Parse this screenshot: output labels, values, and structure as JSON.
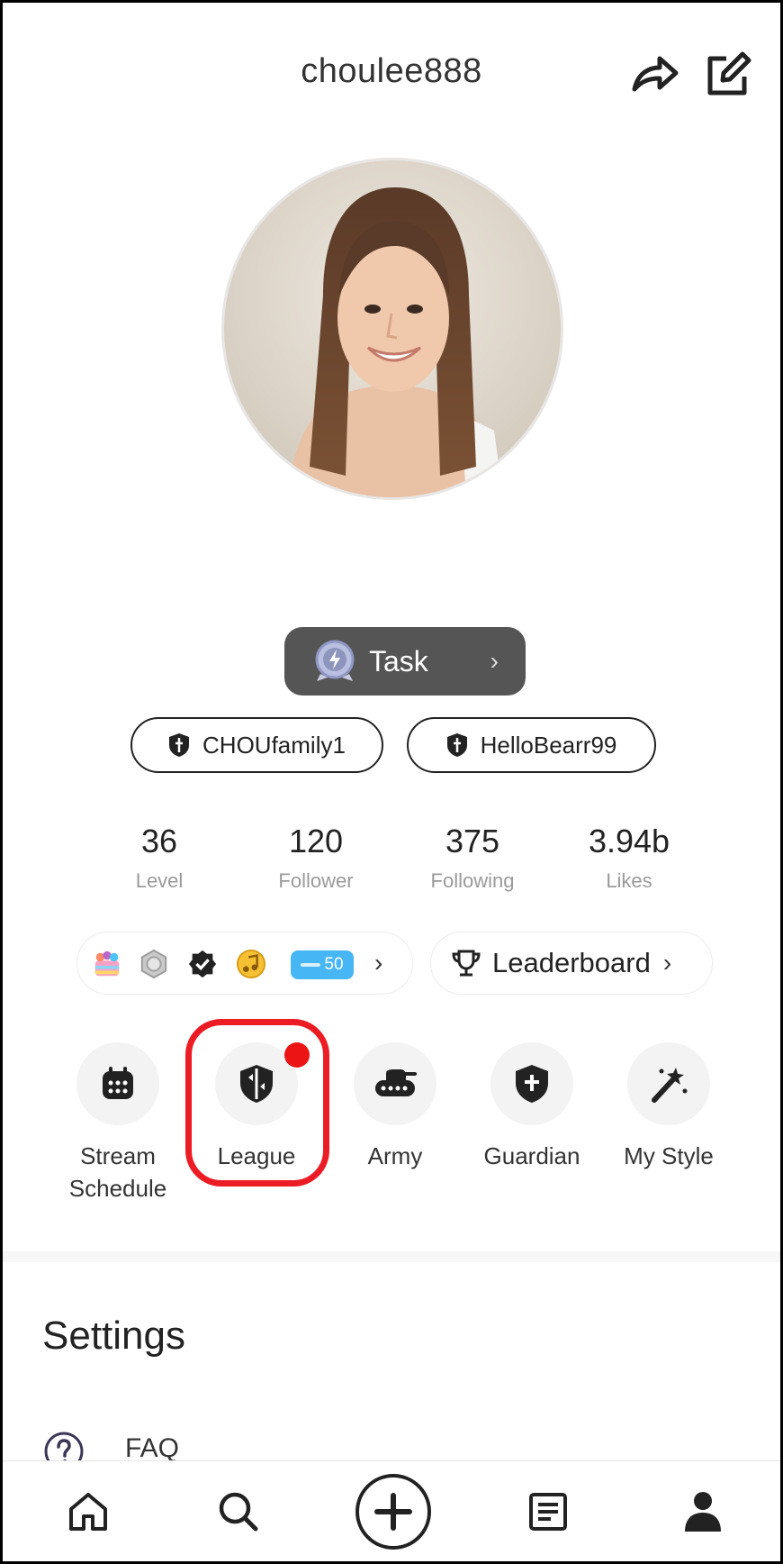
{
  "header": {
    "username": "choulee888",
    "share_icon": "share-icon",
    "edit_icon": "edit-icon"
  },
  "profile": {
    "avatar_alt": "profile photo"
  },
  "task": {
    "label": "Task",
    "icon": "task-medal-icon"
  },
  "teams": [
    {
      "label": "CHOUfamily1",
      "icon": "shield-icon"
    },
    {
      "label": "HelloBearr99",
      "icon": "shield-icon"
    }
  ],
  "stats": [
    {
      "value": "36",
      "label": "Level"
    },
    {
      "value": "120",
      "label": "Follower"
    },
    {
      "value": "375",
      "label": "Following"
    },
    {
      "value": "3.94b",
      "label": "Likes"
    }
  ],
  "badges": {
    "level_pill": "50",
    "icons": [
      "rainbow-cake-badge-icon",
      "silver-rank-badge-icon",
      "verified-badge-icon",
      "music-note-badge-icon"
    ]
  },
  "leaderboard": {
    "label": "Leaderboard",
    "icon": "trophy-icon"
  },
  "features": [
    {
      "label": "Stream Schedule",
      "icon": "calendar-icon"
    },
    {
      "label": "League",
      "icon": "league-shield-icon",
      "has_notification": true
    },
    {
      "label": "Army",
      "icon": "tank-icon"
    },
    {
      "label": "Guardian",
      "icon": "guardian-shield-icon"
    },
    {
      "label": "My Style",
      "icon": "magic-wand-icon"
    }
  ],
  "settings": {
    "title": "Settings",
    "items": [
      {
        "label": "FAQ",
        "icon": "question-circle-icon"
      }
    ]
  },
  "bottom_nav": [
    "home-icon",
    "search-icon",
    "plus-icon",
    "feed-icon",
    "profile-icon"
  ],
  "colors": {
    "highlight": "#ec1c24",
    "notification": "#ec1414",
    "task_pill": "#555555",
    "level_pill": "#47b6f4"
  }
}
